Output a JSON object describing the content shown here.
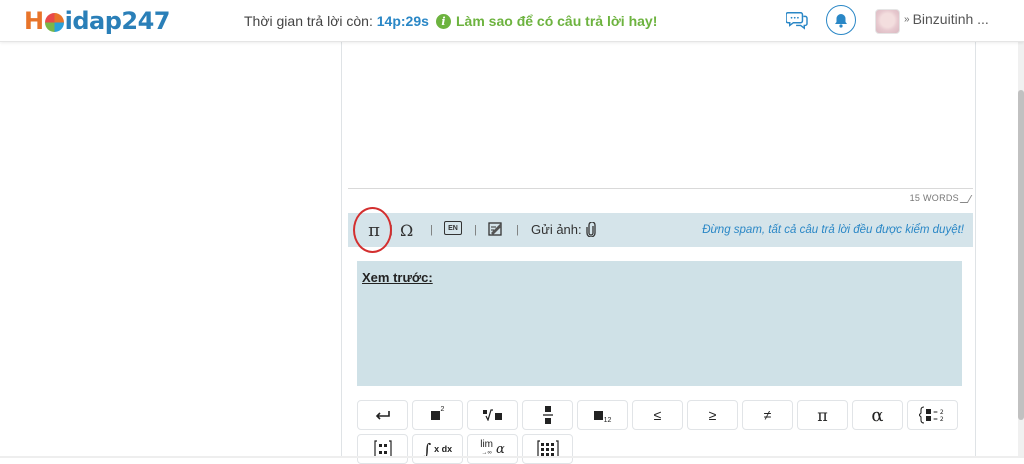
{
  "header": {
    "logo_prefix": "H",
    "logo_text": "idap",
    "logo_num": "247",
    "timer_label": "Thời gian trả lời còn:",
    "timer_value": "14p:29s",
    "tip_text": "Làm sao để có câu trả lời hay!",
    "username": "Binzuitinh ...",
    "icons": [
      "chat-icon",
      "bell-icon",
      "avatar",
      "chevron-down-icon"
    ]
  },
  "editor": {
    "word_count": "15 WORDS"
  },
  "toolbar": {
    "pi": "π",
    "omega": "Ω",
    "en": "EN",
    "sep": "|",
    "upload_label": "Gửi ảnh:",
    "warning": "Đừng spam, tất cả câu trả lời đều được kiểm duyệt!",
    "highlight_color": "#d32f2f"
  },
  "preview": {
    "label": "Xem trước:"
  },
  "symbols": {
    "row1": [
      "↵",
      "x²",
      "√",
      "frac",
      "x₁₂",
      "≤",
      "≥",
      "≠",
      "π",
      "α",
      "system"
    ],
    "row2": [
      "matrix",
      "∫ x dx",
      "lim α",
      "grid"
    ],
    "leq": "≤",
    "geq": "≥",
    "neq": "≠",
    "pi": "π",
    "alpha": "α",
    "sup2": "2",
    "sub12": "12",
    "lim": "lim",
    "lim_to": "→∞",
    "alpha_small": "α",
    "integral": "∫",
    "xdx": "x dx",
    "eq2": "= 2"
  },
  "colors": {
    "accent": "#2a87c6",
    "tip_green": "#6db33f",
    "toolbar_bg": "#d5e4ea",
    "preview_bg": "#cfe1e7"
  }
}
